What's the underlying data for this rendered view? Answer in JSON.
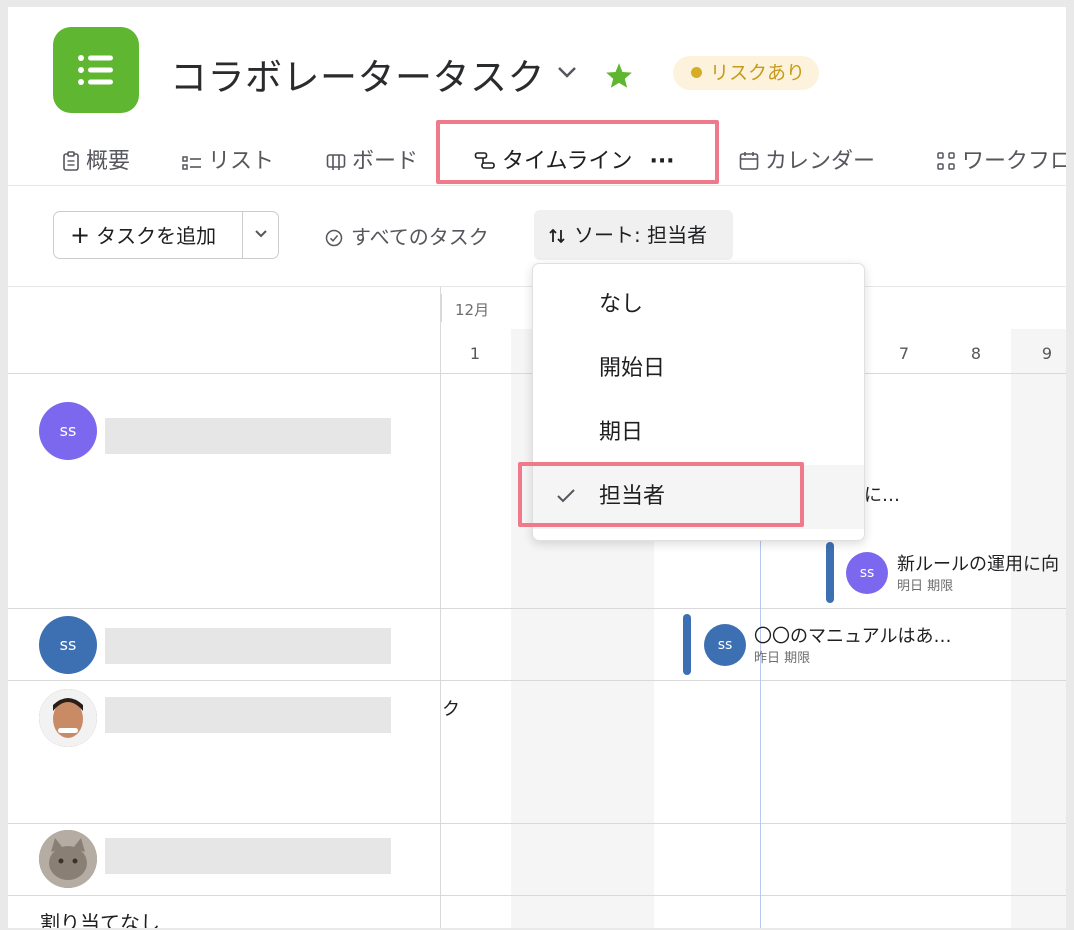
{
  "project": {
    "title": "コラボレータータスク",
    "status_badge": "リスクあり"
  },
  "tabs": [
    {
      "label": "概要"
    },
    {
      "label": "リスト"
    },
    {
      "label": "ボード"
    },
    {
      "label": "タイムライン",
      "more": "···"
    },
    {
      "label": "カレンダー"
    },
    {
      "label": "ワークフロー"
    }
  ],
  "toolbar": {
    "add_task": "タスクを追加",
    "all_tasks": "すべてのタスク",
    "sort": "ソート: 担当者"
  },
  "timeline": {
    "month": "12月",
    "days": [
      "1",
      "7",
      "8",
      "9"
    ]
  },
  "sort_menu": {
    "items": [
      {
        "label": "なし",
        "checked": false
      },
      {
        "label": "開始日",
        "checked": false
      },
      {
        "label": "期日",
        "checked": false
      },
      {
        "label": "担当者",
        "checked": true
      }
    ]
  },
  "rows": [
    {
      "avatar_initials": "ss"
    },
    {
      "avatar_initials": "ss"
    },
    {
      "avatar_initials": ""
    },
    {
      "avatar_initials": ""
    }
  ],
  "unassigned_label": "割り当てなし",
  "stray_text": "ク",
  "tasks": [
    {
      "name": "に…",
      "due": ""
    },
    {
      "name": "新ルールの運用に向",
      "due": "明日 期限",
      "avatar": "ss"
    },
    {
      "name": "〇〇のマニュアルはあ…",
      "due": "昨日 期限",
      "avatar": "ss"
    }
  ],
  "colors": {
    "app_icon": "#5fb631",
    "star": "#5fb631",
    "risk_badge_bg": "#fdf3dc",
    "risk_badge_text": "#c79a1c",
    "highlight": "#f0798c",
    "avatar_purple": "#7b68ee",
    "avatar_blue": "#3d70b2",
    "task_bar": "#3d70b2"
  }
}
